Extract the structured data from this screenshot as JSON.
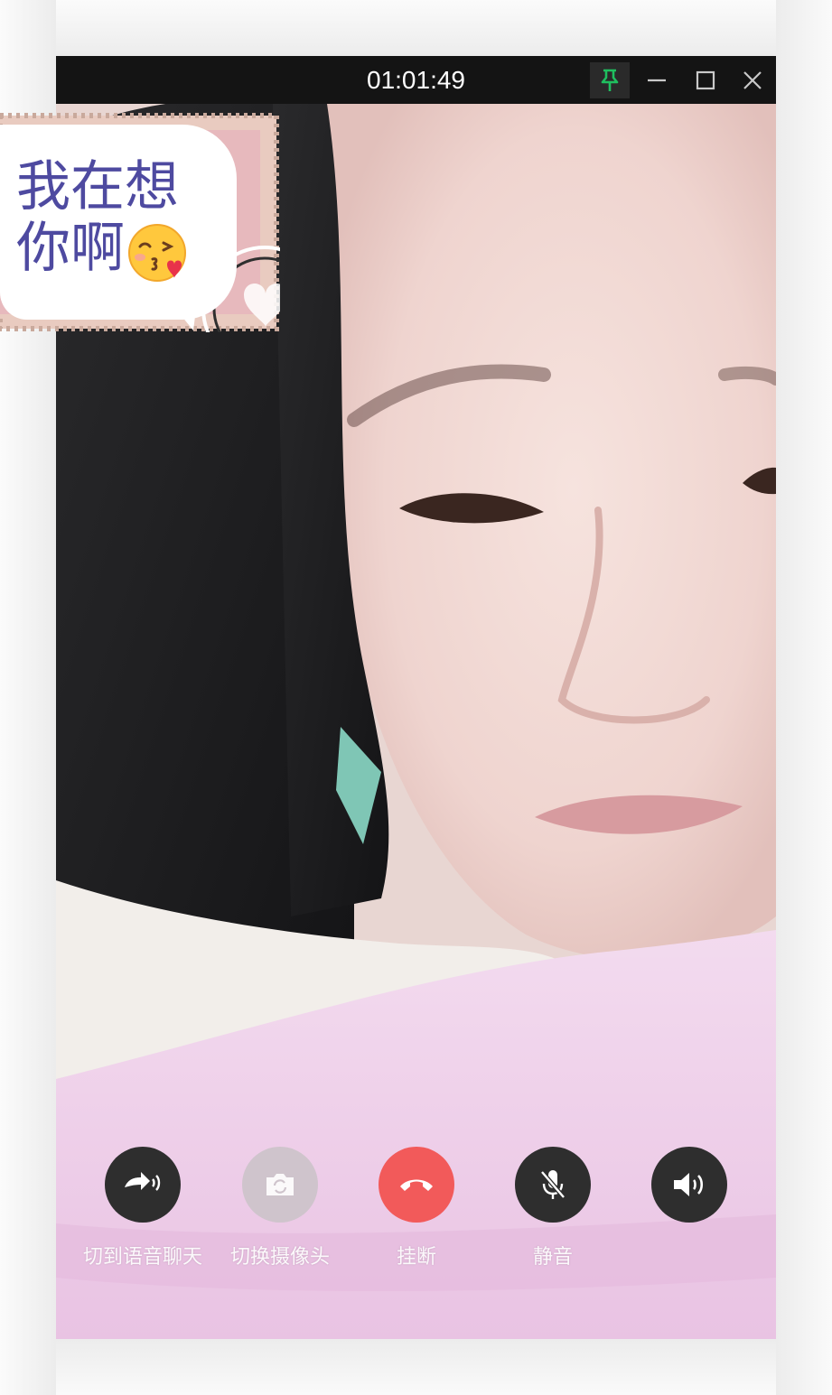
{
  "window": {
    "timer": "01:01:49",
    "title_buttons": [
      "pin-icon",
      "minimize-icon",
      "maximize-icon",
      "close-icon"
    ]
  },
  "sticker": {
    "line1": "我在想",
    "line2": "你啊",
    "emoji": "kissing-face-icon"
  },
  "controls": [
    {
      "label": "切到语音聊天",
      "icon": "switch-to-voice-icon",
      "color": "#2e2e2e"
    },
    {
      "label": "切换摄像头",
      "icon": "camera-switch-icon",
      "color": "#cfc4cc"
    },
    {
      "label": "挂断",
      "icon": "hang-up-icon",
      "color": "#f25a5a"
    },
    {
      "label": "静音",
      "icon": "mic-mute-icon",
      "color": "#2e2e2e"
    },
    {
      "label": "",
      "icon": "speaker-icon",
      "color": "#2e2e2e"
    }
  ],
  "colors": {
    "pin_active": "#1fbf5f",
    "hangup": "#f25a5a",
    "bubble_text": "#4e4aa0"
  }
}
